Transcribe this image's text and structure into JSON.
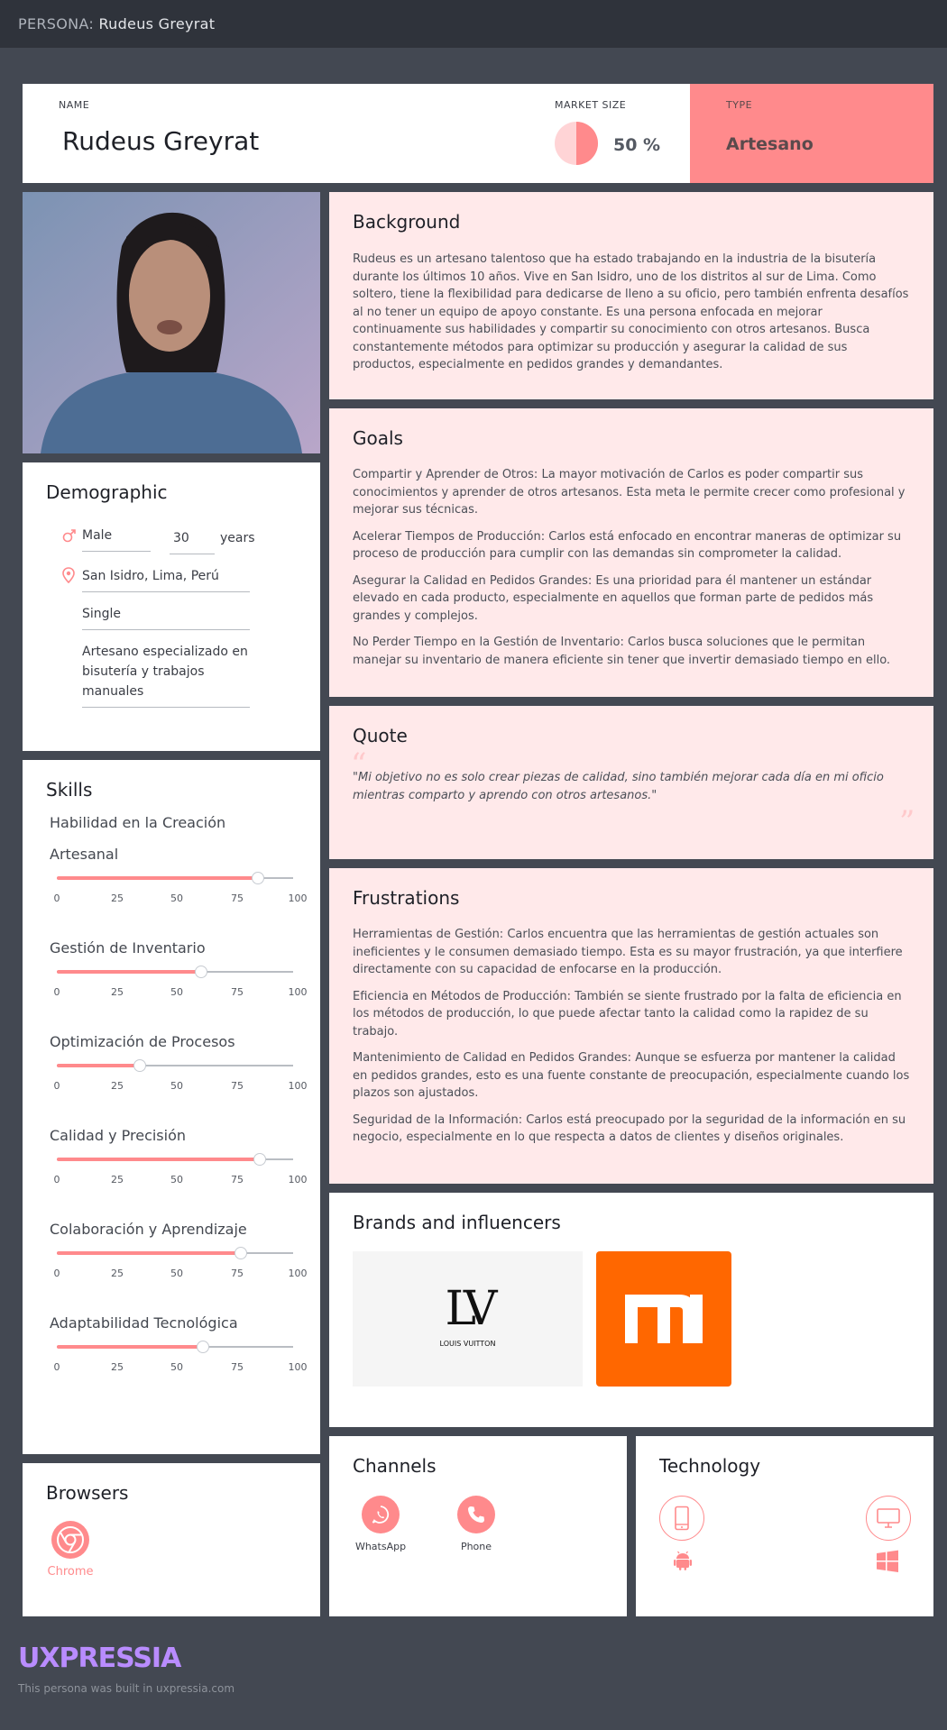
{
  "topbar": {
    "prefix": "PERSONA:",
    "name": "Rudeus Greyrat"
  },
  "header": {
    "name_label": "NAME",
    "name": "Rudeus Greyrat",
    "market_label": "MARKET SIZE",
    "market_value": "50 %",
    "market_fraction": 0.5,
    "type_label": "TYPE",
    "type_value": "Artesano"
  },
  "background": {
    "title": "Background",
    "text": "Rudeus es un artesano talentoso que ha estado trabajando en la industria de la bisutería durante los últimos 10 años. Vive en San Isidro, uno de los distritos al sur de Lima. Como soltero, tiene la flexibilidad para dedicarse de lleno a su oficio, pero también enfrenta desafíos al no tener un equipo de apoyo constante.  Es una persona enfocada en mejorar continuamente sus habilidades y compartir su conocimiento con otros artesanos. Busca constantemente métodos para optimizar su producción y asegurar la calidad de sus productos, especialmente en pedidos grandes y demandantes."
  },
  "goals": {
    "title": "Goals",
    "items": [
      "Compartir y Aprender de Otros: La mayor motivación de Carlos es poder compartir sus conocimientos y aprender de otros artesanos. Esta meta le permite crecer como profesional y mejorar sus técnicas.",
      "Acelerar Tiempos de Producción: Carlos está enfocado en encontrar maneras de optimizar su proceso de producción para cumplir con las demandas sin comprometer la calidad.",
      "Asegurar la Calidad en Pedidos Grandes: Es una prioridad para él mantener un estándar elevado en cada producto, especialmente en aquellos que forman parte de pedidos más grandes y complejos.",
      "No Perder Tiempo en la Gestión de Inventario: Carlos busca soluciones que le permitan manejar su inventario de manera eficiente sin tener que invertir demasiado tiempo en ello."
    ]
  },
  "quote": {
    "title": "Quote",
    "text": "\"Mi objetivo no es solo crear piezas de calidad, sino también mejorar cada día en mi oficio mientras comparto y aprendo con otros artesanos.\"",
    "open_mark": "“",
    "close_mark": "”"
  },
  "frustrations": {
    "title": "Frustrations",
    "items": [
      "Herramientas de Gestión: Carlos encuentra que las herramientas de gestión actuales son ineficientes y le consumen demasiado tiempo. Esta es su mayor frustración, ya que interfiere directamente con su capacidad de enfocarse en la producción.",
      "Eficiencia en Métodos de Producción: También se siente frustrado por la falta de eficiencia en los métodos de producción, lo que puede afectar tanto la calidad como la rapidez de su trabajo.",
      "Mantenimiento de Calidad en Pedidos Grandes: Aunque se esfuerza por mantener la calidad en pedidos grandes, esto es una fuente constante de preocupación, especialmente cuando los plazos son ajustados.",
      "Seguridad de la Información: Carlos está preocupado por la seguridad de la información en su negocio, especialmente en lo que respecta a datos de clientes y diseños originales."
    ]
  },
  "brands": {
    "title": "Brands and influencers",
    "items": [
      {
        "name": "LOUIS VUITTON",
        "mark": "LV"
      },
      {
        "name": "Xiaomi",
        "mark": "mi"
      }
    ]
  },
  "demographic": {
    "title": "Demographic",
    "gender": "Male",
    "age": "30",
    "age_unit": "years",
    "location": "San Isidro, Lima, Perú",
    "status": "Single",
    "occupation": "Artesano especializado en bisutería y trabajos manuales"
  },
  "skills": {
    "title": "Skills",
    "category": "Habilidad en la Creación",
    "ticks": [
      "0",
      "25",
      "50",
      "75",
      "100"
    ],
    "items": [
      {
        "name": "Artesanal",
        "value": 85
      },
      {
        "name": "Gestión de Inventario",
        "value": 61
      },
      {
        "name": "Optimización de Procesos",
        "value": 35
      },
      {
        "name": "Calidad y Precisión",
        "value": 86
      },
      {
        "name": "Colaboración y Aprendizaje",
        "value": 78
      },
      {
        "name": "Adaptabilidad Tecnológica",
        "value": 62
      }
    ]
  },
  "browsers": {
    "title": "Browsers",
    "items": [
      {
        "name": "Chrome",
        "icon": "chrome-icon"
      }
    ]
  },
  "channels": {
    "title": "Channels",
    "items": [
      {
        "name": "WhatsApp",
        "icon": "whatsapp-icon"
      },
      {
        "name": "Phone",
        "icon": "phone-icon"
      }
    ]
  },
  "technology": {
    "title": "Technology",
    "items": [
      {
        "icon": "smartphone-icon"
      },
      {
        "icon": "android-icon"
      },
      {
        "icon": "desktop-icon"
      },
      {
        "icon": "windows-icon"
      }
    ]
  },
  "footer": {
    "logo": "UXPRESSIA",
    "note": "This persona was built in uxpressia.com"
  },
  "colors": {
    "accent": "#ff8a8c",
    "pink_bg": "#ffe9ea",
    "page_bg": "#434852",
    "topbar_bg": "#2f333b",
    "logo": "#b98cff"
  }
}
